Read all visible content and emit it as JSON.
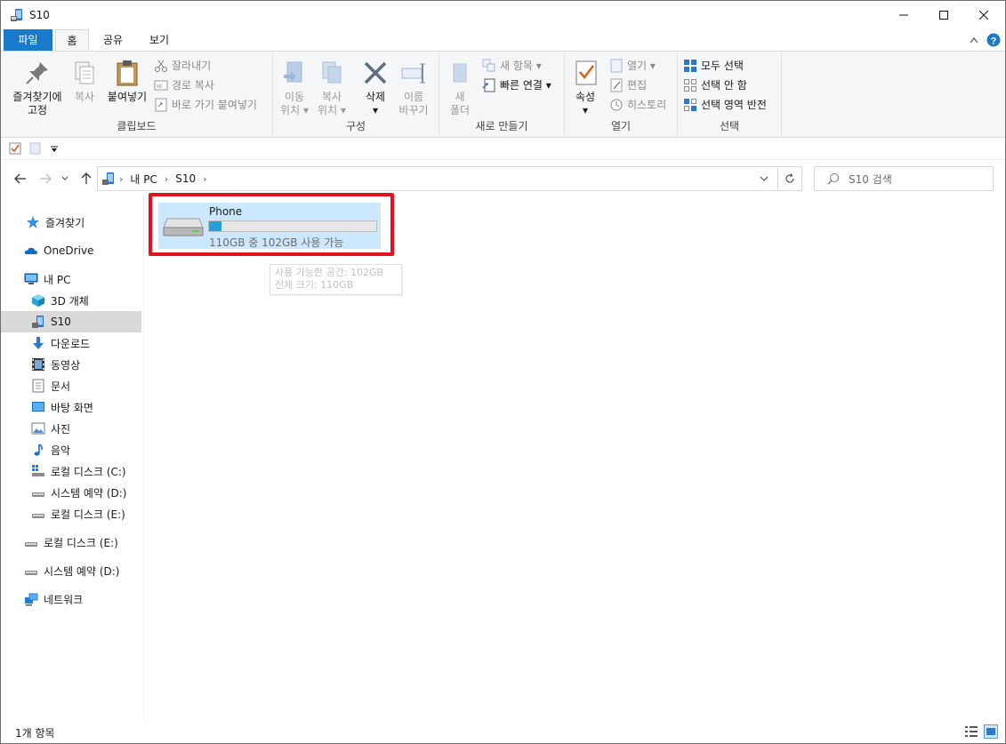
{
  "window": {
    "title": "S10"
  },
  "ribbon_tabs": {
    "file": "파일",
    "home": "홈",
    "share": "공유",
    "view": "보기"
  },
  "ribbon": {
    "clipboard": {
      "label": "클립보드",
      "pin": "즐겨찾기에",
      "pin2": "고정",
      "copy": "복사",
      "paste": "붙여넣기",
      "cut": "잘라내기",
      "copy_path": "경로 복사",
      "paste_shortcut": "바로 가기 붙여넣기"
    },
    "organize": {
      "label": "구성",
      "move1": "이동",
      "move2": "위치",
      "copyto1": "복사",
      "copyto2": "위치",
      "delete": "삭제",
      "rename1": "이름",
      "rename2": "바꾸기"
    },
    "new": {
      "label": "새로 만들기",
      "new_folder1": "새",
      "new_folder2": "폴더",
      "new_item": "새 항목",
      "easy_access": "빠른 연결"
    },
    "open": {
      "label": "열기",
      "properties": "속성",
      "open": "열기",
      "edit": "편집",
      "history": "히스토리"
    },
    "select": {
      "label": "선택",
      "select_all": "모두 선택",
      "select_none": "선택 안 함",
      "invert": "선택 영역 반전"
    }
  },
  "address": {
    "crumbs": [
      "내 PC",
      "S10"
    ],
    "search_placeholder": "S10 검색"
  },
  "nav": {
    "quick_access": "즐겨찾기",
    "onedrive": "OneDrive",
    "this_pc": "내 PC",
    "objects3d": "3D 개체",
    "s10": "S10",
    "downloads": "다운로드",
    "videos": "동영상",
    "documents": "문서",
    "desktop": "바탕 화면",
    "pictures": "사진",
    "music": "음악",
    "local_c": "로컬 디스크 (C:)",
    "reserved_d": "시스템 예약 (D:)",
    "local_e": "로컬 디스크 (E:)",
    "local_e2": "로컬 디스크 (E:)",
    "reserved_d2": "시스템 예약 (D:)",
    "network": "네트워크"
  },
  "drive": {
    "name": "Phone",
    "free_text": "110GB 중 102GB 사용 가능",
    "used_fraction": 0.073
  },
  "tooltip": {
    "line1": "사용 가능한 공간: 102GB",
    "line2": "전체 크기: 110GB"
  },
  "status": {
    "count": "1개 항목"
  },
  "colors": {
    "accent": "#1979ca",
    "highlight": "#e0141e",
    "selection": "#cce8ff"
  }
}
